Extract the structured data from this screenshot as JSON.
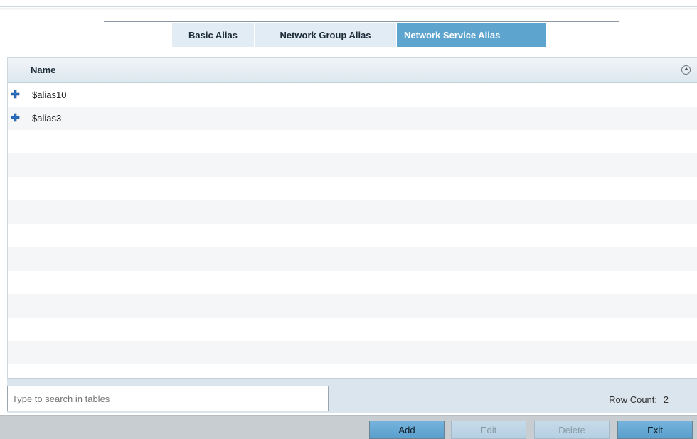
{
  "tabs": [
    {
      "label": "Basic Alias",
      "active": false
    },
    {
      "label": "Network Group Alias",
      "active": false
    },
    {
      "label": "Network Service Alias",
      "active": true
    }
  ],
  "table": {
    "columns": [
      "Name"
    ],
    "rows": [
      {
        "name": "$alias10"
      },
      {
        "name": "$alias3"
      }
    ]
  },
  "footer": {
    "search_placeholder": "Type to search in tables",
    "row_count_label": "Row Count:",
    "row_count_value": "2"
  },
  "buttons": {
    "add": "Add",
    "edit": "Edit",
    "delete": "Delete",
    "exit": "Exit"
  },
  "colors": {
    "active_tab": "#5da4cf",
    "inactive_tab": "#e2ecf4",
    "expand_icon": "#2b6fc0"
  }
}
